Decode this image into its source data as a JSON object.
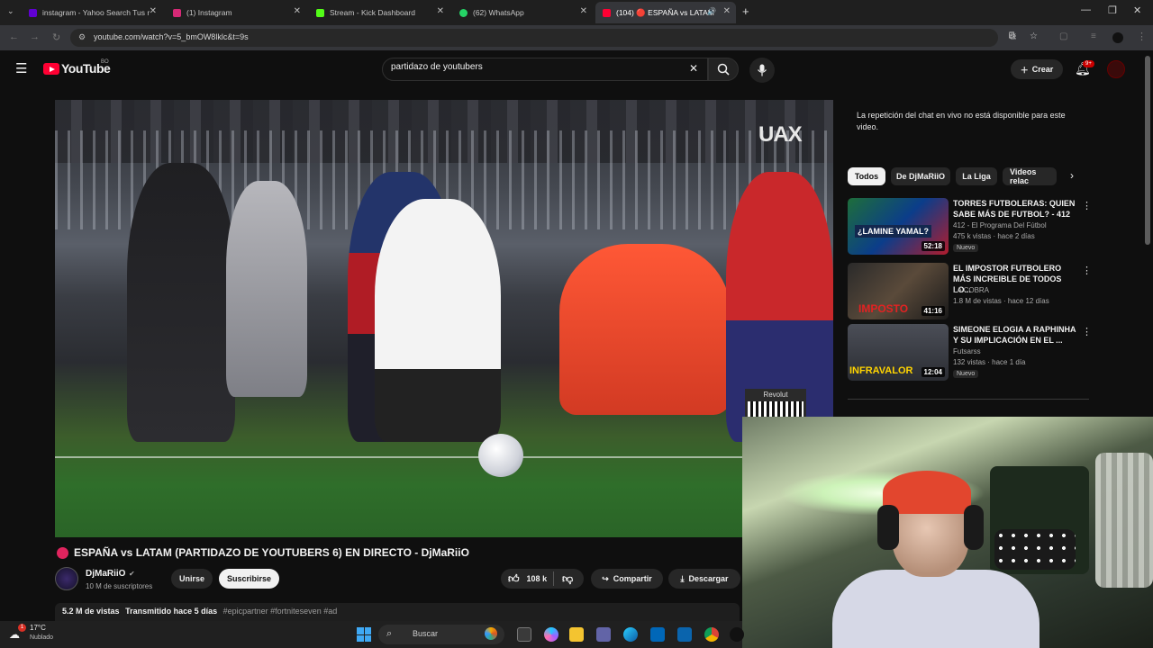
{
  "browser": {
    "tabs": [
      {
        "label": "instagram - Yahoo Search Tus r",
        "favicon": "yahoo-icon",
        "color": "#6001d2"
      },
      {
        "label": "(1) Instagram",
        "favicon": "instagram-icon",
        "color": "#d62976"
      },
      {
        "label": "Stream - Kick Dashboard",
        "favicon": "kick-icon",
        "color": "#53fc18"
      },
      {
        "label": "(62) WhatsApp",
        "favicon": "whatsapp-icon",
        "color": "#25d366"
      },
      {
        "label": "(104) 🔴 ESPAÑA vs LATAM",
        "favicon": "youtube-icon",
        "color": "#ff0033"
      }
    ],
    "url": "youtube.com/watch?v=5_bmOW8lklc&t=9s"
  },
  "youtube": {
    "logo_text": "YouTube",
    "country_code": "BO",
    "search_value": "partidazo de youtubers",
    "create_label": "Crear",
    "notification_count": "9+"
  },
  "video": {
    "overlay_text": "UAX",
    "sponsor_label": "Revolut",
    "title": "ESPAÑA vs LATAM (PARTIDAZO DE YOUTUBERS 6) EN DIRECTO - DjMaRiiO",
    "channel_name": "DjMaRiiO",
    "subscribers": "10 M de suscriptores",
    "join_label": "Unirse",
    "subscribe_label": "Subscribe",
    "subscribe_label_shown": "Suscribirse",
    "likes": "108 k",
    "share_label": "Compartir",
    "download_label": "Descargar",
    "views": "5.2 M de vistas",
    "streamed": "Transmitido hace 5 días",
    "hashtags": "#epicpartner #fortniteseven #ad"
  },
  "sidebar": {
    "chat_notice": "La repetición del chat en vivo no está disponible para este video.",
    "chips": [
      "Todos",
      "De DjMaRiiO",
      "La Liga",
      "Videos relac"
    ],
    "recommendations": [
      {
        "title": "TORRES FUTBOLERAS: QUIEN SABE MÁS DE FUTBOL? - 412",
        "channel": "412 - El Programa Del Fútbol",
        "meta": "475 k vistas · hace 2 días",
        "badge": "Nuevo",
        "duration": "52:18",
        "thumb_text": "¿LAMINE YAMAL?"
      },
      {
        "title": "EL IMPOSTOR FUTBOLERO MÁS INCREIBLE DE TODOS LO...",
        "channel": "LA COBRA",
        "meta": "1.8 M de vistas · hace 12 días",
        "badge": "",
        "duration": "41:16",
        "thumb_text": "IMPOSTO"
      },
      {
        "title": "SIMEONE ELOGIA A RAPHINHA Y SU IMPLICACIÓN EN EL ...",
        "channel": "Futsarss",
        "meta": "132 vistas · hace 1 día",
        "badge": "Nuevo",
        "duration": "12:04",
        "thumb_text": "INFRAVALOR"
      }
    ]
  },
  "taskbar": {
    "temperature": "17°C",
    "weather": "Nublado",
    "weather_badge": "1",
    "search_placeholder": "Buscar"
  }
}
